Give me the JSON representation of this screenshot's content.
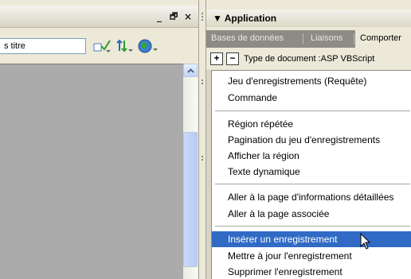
{
  "left_window": {
    "controls": {
      "minimize": "_",
      "restore": "🗗",
      "close": "×"
    },
    "title_field_value": "s titre"
  },
  "panel": {
    "title": "▼ Application",
    "tabs": [
      "Bases de données",
      "Liaisons",
      "Comporter"
    ],
    "active_tab": "Comporter",
    "add_button": "+",
    "remove_button": "−",
    "doc_type": "Type de document :ASP VBScript"
  },
  "context_menu": {
    "groups": [
      {
        "items": [
          "Jeu d'enregistrements (Requête)",
          "Commande"
        ]
      },
      {
        "items": [
          "Région répétée",
          "Pagination du jeu d'enregistrements",
          "Afficher la région",
          "Texte dynamique"
        ]
      },
      {
        "items": [
          "Aller à la page d'informations détaillées",
          "Aller à la page associée"
        ]
      },
      {
        "items": [
          "Insérer un enregistrement",
          "Mettre à jour l'enregistrement",
          "Supprimer l'enregistrement"
        ]
      }
    ],
    "highlighted": "Insérer un enregistrement"
  },
  "colors": {
    "highlight": "#316ac5",
    "doc_bg": "#ababab",
    "tab_bar": "#8c8c84"
  }
}
